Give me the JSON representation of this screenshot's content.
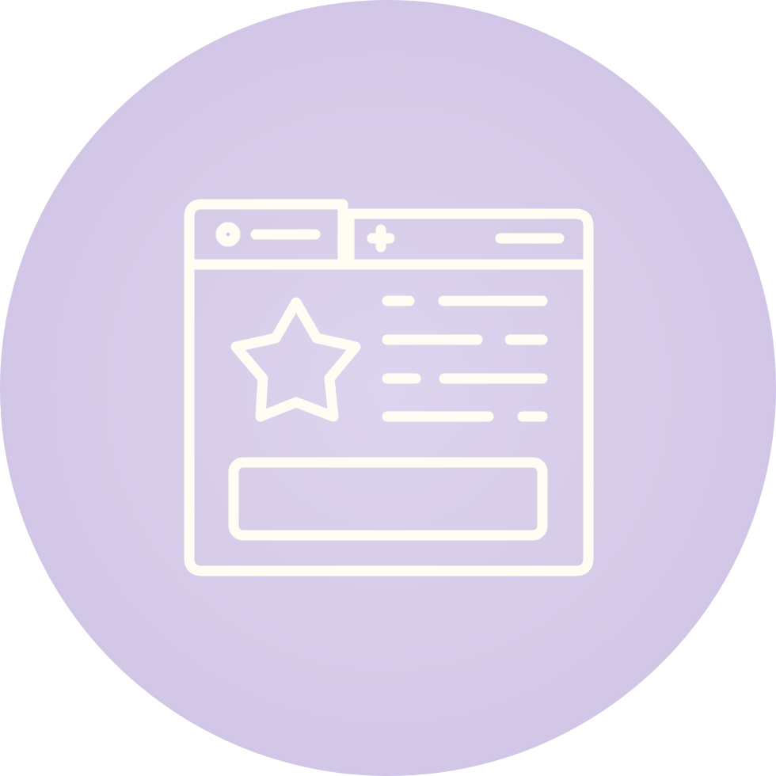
{
  "icon": {
    "name": "browser-favorite-page-icon",
    "background_color": "#d5cae7",
    "stroke_color": "#fffdf3"
  }
}
